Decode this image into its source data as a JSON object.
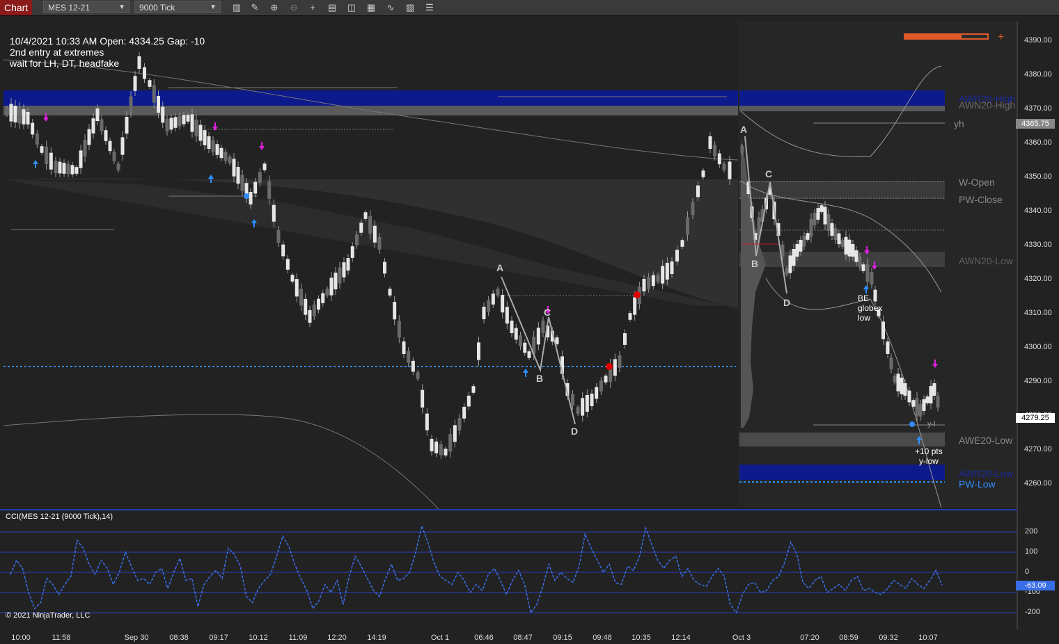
{
  "toolbar": {
    "tab": "Chart",
    "instrument": "MES 12-21",
    "period": "9000 Tick"
  },
  "info": {
    "line1": "10/4/2021 10:33 AM   Open: 4334.25   Gap: -10",
    "line2": "2nd entry at extremes",
    "line3": "wait for LH, DT, headfake"
  },
  "price_axis": [
    "4390.00",
    "4380.00",
    "4370.00",
    "4360.00",
    "4350.00",
    "4340.00",
    "4330.00",
    "4320.00",
    "4310.00",
    "4300.00",
    "4290.00",
    "4280.00",
    "4270.00",
    "4260.00"
  ],
  "price_tags": {
    "yh": "4365.75",
    "last": "4279.25"
  },
  "time_axis": [
    "10:00",
    "11:58",
    "Sep 30",
    "08:38",
    "09:17",
    "10:12",
    "11:09",
    "12:20",
    "14:19",
    "Oct 1",
    "06:46",
    "08:47",
    "09:15",
    "09:48",
    "10:35",
    "12:14",
    "Oct 3",
    "07:20",
    "08:59",
    "09:32",
    "10:07"
  ],
  "annotations": {
    "left_A": "A",
    "left_B": "B",
    "left_C": "C",
    "left_D": "D",
    "right_A": "A",
    "right_B": "B",
    "right_C": "C",
    "right_D": "D"
  },
  "levels": {
    "awr20_high": "AWR20-High",
    "awn20_high": "AWN20-High",
    "yh": "yh",
    "w_open": "W-Open",
    "pw_close": "PW-Close",
    "awn20_low": "AWN20-Low",
    "awe20_low": "AWE20-Low",
    "awr20_low": "AWR20-Low",
    "pw_low": "PW-Low"
  },
  "notes": {
    "be_1": "BE",
    "be_2": "globex",
    "be_3": "low",
    "pts_1": "+10 pts",
    "pts_2": "y-low",
    "ylow_small": "y-l"
  },
  "cci": {
    "label": "CCI(MES 12-21 (9000 Tick),14)",
    "axis": [
      "200",
      "100",
      "0",
      "-100",
      "-200"
    ],
    "value": "-63.09"
  },
  "copyright": "© 2021 NinjaTrader, LLC",
  "colors": {
    "background": "#222222",
    "toolbar": "#3a3a3a",
    "tab": "#8b1a1a",
    "cci_line": "#3a6ee8",
    "blue_zone": "#0c1a8c",
    "dotted_level": "#2f8cff",
    "magenta_arrow": "#e020e0",
    "cyan_arrow": "#2a90ff"
  },
  "icons": [
    "bars-icon",
    "pencil-icon",
    "zoom-in-icon",
    "zoom-out-icon",
    "crosshair-icon",
    "properties-icon",
    "indicators-icon",
    "strategies-icon",
    "drawing-tools-icon",
    "data-box-icon",
    "list-icon"
  ]
}
